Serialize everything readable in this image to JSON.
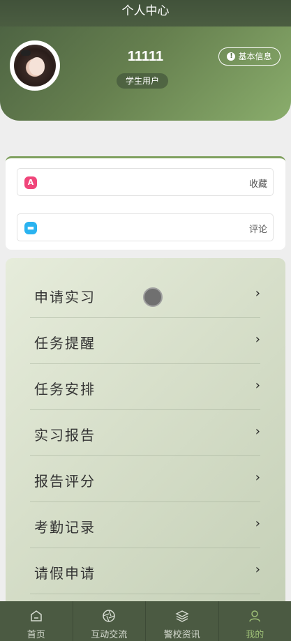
{
  "header": {
    "title": "个人中心"
  },
  "profile": {
    "username": "11111",
    "role": "学生用户",
    "info_button": "基本信息"
  },
  "quick_links": [
    {
      "label": "收藏",
      "icon": "bookmark-icon",
      "color": "#f0457a"
    },
    {
      "label": "评论",
      "icon": "comment-icon",
      "color": "#2ab3f0"
    }
  ],
  "menu": {
    "items": [
      {
        "label": "申请实习"
      },
      {
        "label": "任务提醒"
      },
      {
        "label": "任务安排"
      },
      {
        "label": "实习报告"
      },
      {
        "label": "报告评分"
      },
      {
        "label": "考勤记录"
      },
      {
        "label": "请假申请"
      }
    ],
    "chevron": "›"
  },
  "tabbar": {
    "tabs": [
      {
        "label": "首页",
        "icon": "home-icon"
      },
      {
        "label": "互动交流",
        "icon": "aperture-icon"
      },
      {
        "label": "警校资讯",
        "icon": "layers-icon"
      },
      {
        "label": "我的",
        "icon": "user-icon",
        "active": true
      }
    ]
  },
  "colors": {
    "accent": "#9dbf76",
    "header": "#41523a",
    "tabbar": "#4b5a42"
  }
}
